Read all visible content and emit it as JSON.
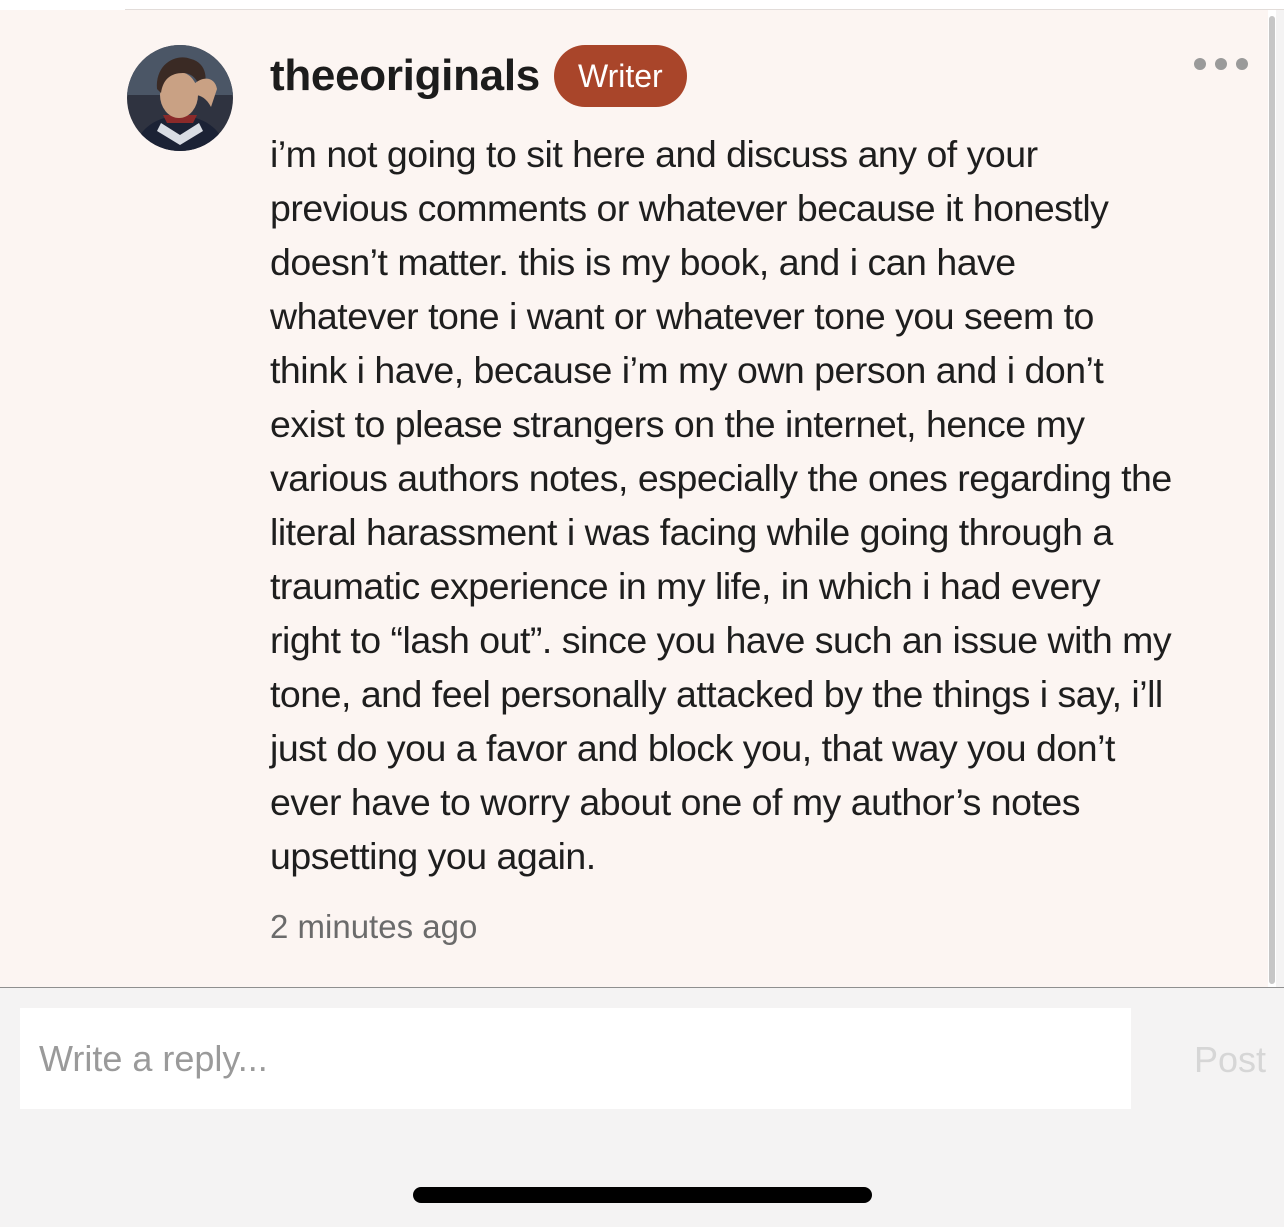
{
  "comment": {
    "author": "theeoriginals",
    "role_badge": "Writer",
    "more_icon": "more-horizontal-icon",
    "body_lines": [
      "i’m not going to sit here and discuss any of your",
      "previous comments or whatever because it honestly",
      "doesn’t matter. this is my book, and i can have",
      "whatever tone i want or whatever tone you seem to",
      "think i have, because i’m my own person and i don’t",
      "exist to please strangers on the internet, hence my",
      "various authors notes, especially the ones regarding the",
      "literal harassment i was facing while going through a",
      "traumatic experience in my life, in which i had every",
      "right to “lash out”. since you have such an issue with my",
      "tone, and feel personally attacked by the things i say, i’ll",
      "just do you a favor and block you, that way you don’t",
      "ever have to worry about one of my author’s notes",
      "upsetting you again."
    ],
    "timestamp": "2 minutes ago"
  },
  "reply": {
    "placeholder": "Write a reply...",
    "value": "",
    "post_label": "Post"
  },
  "colors": {
    "badge": "#a9452a",
    "panel_background": "#fcf5f2",
    "page_background": "#f4f3f3",
    "post_disabled": "#d6d6d6"
  }
}
